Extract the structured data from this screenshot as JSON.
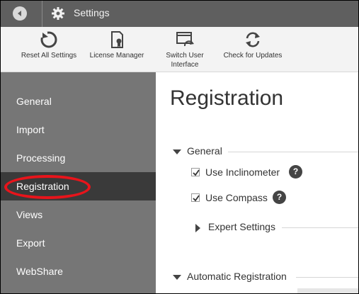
{
  "window": {
    "title": "Settings"
  },
  "toolbar": {
    "items": [
      {
        "label": "Reset All Settings",
        "icon": "reset-icon"
      },
      {
        "label": "License Manager",
        "icon": "license-icon"
      },
      {
        "label": "Switch User Interface",
        "icon": "switch-ui-icon"
      },
      {
        "label": "Check for Updates",
        "icon": "refresh-icon"
      }
    ]
  },
  "sidebar": {
    "items": [
      {
        "label": "General"
      },
      {
        "label": "Import"
      },
      {
        "label": "Processing"
      },
      {
        "label": "Registration",
        "active": true
      },
      {
        "label": "Views"
      },
      {
        "label": "Export"
      },
      {
        "label": "WebShare"
      }
    ]
  },
  "main": {
    "title": "Registration",
    "general_section": {
      "label": "General",
      "expanded": true
    },
    "options": [
      {
        "label": "Use Inclinometer",
        "checked": true,
        "help": "?"
      },
      {
        "label": "Use Compass",
        "checked": true,
        "help": "?"
      }
    ],
    "expert_section": {
      "label": "Expert Settings",
      "expanded": false
    },
    "auto_section": {
      "label": "Automatic Registration",
      "expanded": true
    }
  },
  "colors": {
    "titlebar": "#5f5f5f",
    "sidebar": "#767676",
    "sidebar_active": "#3a3a3a",
    "highlight": "#e8141b"
  }
}
